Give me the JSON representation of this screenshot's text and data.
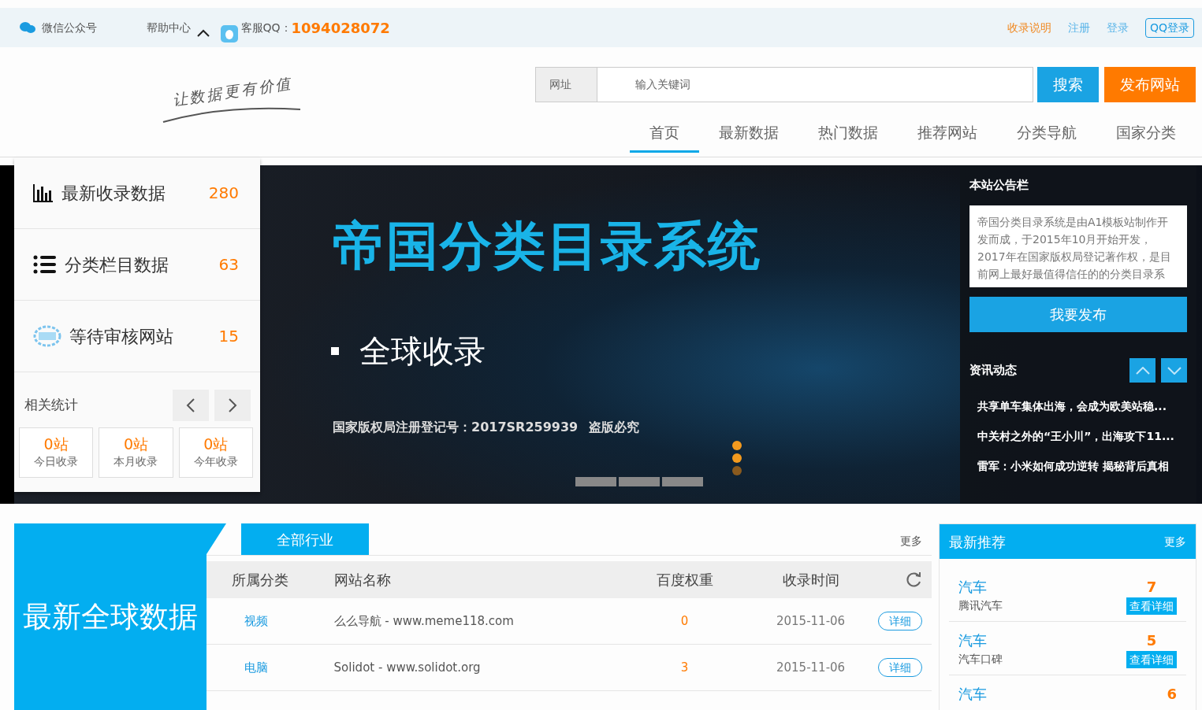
{
  "top_bar": {
    "wechat": "微信公众号",
    "help": "帮助中心",
    "qq_label": "客服QQ：",
    "qq_number": "1094028072",
    "links": [
      {
        "label": "收录说明",
        "kind": "highlight"
      },
      {
        "label": "注册",
        "kind": "plain"
      },
      {
        "label": "登录",
        "kind": "plain"
      },
      {
        "label": "QQ登录",
        "kind": "outlined"
      }
    ]
  },
  "header": {
    "slogan": "让数据更有价值",
    "search": {
      "scope": "网址",
      "placeholder": "输入关键词"
    },
    "buttons": [
      {
        "label": "搜索",
        "kind": "primary"
      },
      {
        "label": "发布网站",
        "kind": "accent"
      }
    ],
    "nav": [
      {
        "label": "首页",
        "selected": true
      },
      {
        "label": "最新数据",
        "selected": false
      },
      {
        "label": "热门数据",
        "selected": false
      },
      {
        "label": "推荐网站",
        "selected": false
      },
      {
        "label": "分类导航",
        "selected": false
      },
      {
        "label": "国家分类",
        "selected": false
      }
    ]
  },
  "stats": {
    "items": [
      {
        "label": "最新收录数据",
        "count": "280",
        "kind": "chart"
      },
      {
        "label": "分类栏目数据",
        "count": "63",
        "kind": "list"
      },
      {
        "label": "等待审核网站",
        "count": "15",
        "kind": "stamp"
      }
    ],
    "related": {
      "title": "相关统计",
      "cells": [
        {
          "value": "0站",
          "label": "今日收录"
        },
        {
          "value": "0站",
          "label": "本月收录"
        },
        {
          "value": "0站",
          "label": "今年收录"
        }
      ]
    }
  },
  "banner": {
    "title": "帝国分类目录系统",
    "bullet_text": "全球收录",
    "registration": "国家版权局注册登记号：2017SR259939",
    "warning": "盗版必究"
  },
  "notice": {
    "title": "本站公告栏",
    "text": "帝国分类目录系统是由A1模板站制作开发而成，于2015年10月开始开发，2017年在国家版权局登记著作权，是目前网上最好最值得信任的的分类目录系",
    "publish_button": "我要发布",
    "news_title": "资讯动态",
    "news": [
      "共享单车集体出海，会成为欧美站稳...",
      "中关村之外的“王小川”，出海攻下11...",
      "雷军：小米如何成功逆转 揭秘背后真相"
    ]
  },
  "latest": {
    "heading": "最新全球数据",
    "tabs": [
      {
        "label": "全部行业",
        "selected": true
      }
    ],
    "more": "更多",
    "columns": [
      "所属分类",
      "网站名称",
      "百度权重",
      "收录时间"
    ],
    "rows": [
      {
        "category": "视频",
        "site": "么么导航 - www.meme118.com",
        "weight": "0",
        "date": "2015-11-06",
        "action": "详细"
      },
      {
        "category": "电脑",
        "site": "Solidot - www.solidot.org",
        "weight": "3",
        "date": "2015-11-06",
        "action": "详细"
      }
    ]
  },
  "recommend": {
    "title": "最新推荐",
    "more": "更多",
    "items": [
      {
        "category": "汽车",
        "name": "腾讯汽车",
        "score": "7",
        "action": "查看详细"
      },
      {
        "category": "汽车",
        "name": "汽车口碑",
        "score": "5",
        "action": "查看详细"
      },
      {
        "category": "汽车",
        "score": "6"
      }
    ]
  }
}
